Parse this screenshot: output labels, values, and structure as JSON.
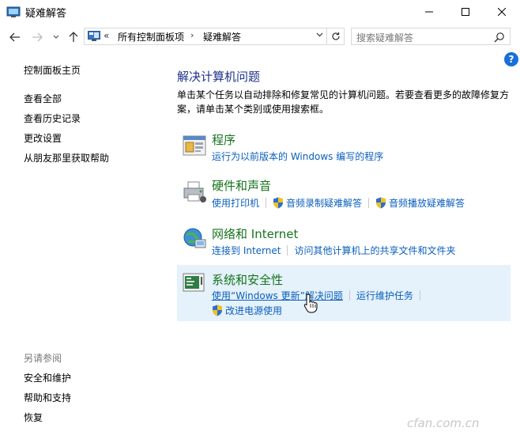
{
  "window": {
    "title": "疑难解答"
  },
  "nav": {
    "address_chevron": "«",
    "address_segments": [
      "所有控制面板项",
      "疑难解答"
    ],
    "address_separator": "›",
    "search_placeholder": "搜索疑难解答",
    "help_label": "?"
  },
  "left_pane": {
    "home": "控制面板主页",
    "links": [
      "查看全部",
      "查看历史记录",
      "更改设置",
      "从朋友那里获取帮助"
    ],
    "see_also_heading": "另请参阅",
    "see_also": [
      "安全和维护",
      "帮助和支持",
      "恢复"
    ]
  },
  "main": {
    "title": "解决计算机问题",
    "description": "单击某个任务以自动排除和修复常见的计算机问题。若要查看更多的故障修复方案，请单击某个类别或使用搜索框。",
    "categories": [
      {
        "title": "程序",
        "links": [
          "运行为以前版本的 Windows 编写的程序"
        ]
      },
      {
        "title": "硬件和声音",
        "links": [
          "使用打印机",
          "音频录制疑难解答",
          "音频播放疑难解答"
        ]
      },
      {
        "title": "网络和 Internet",
        "links": [
          "连接到 Internet",
          "访问其他计算机上的共享文件和文件夹"
        ]
      },
      {
        "title": "系统和安全性",
        "links": [
          "使用“Windows 更新”解决问题",
          "运行维护任务",
          "改进电源使用"
        ]
      }
    ]
  },
  "watermark": "cfan.com.cn",
  "colors": {
    "link": "#0a5fbd",
    "category_title": "#15741c",
    "heading": "#1e3287",
    "highlight": "#e5f1fb",
    "help": "#1a6ed8"
  }
}
